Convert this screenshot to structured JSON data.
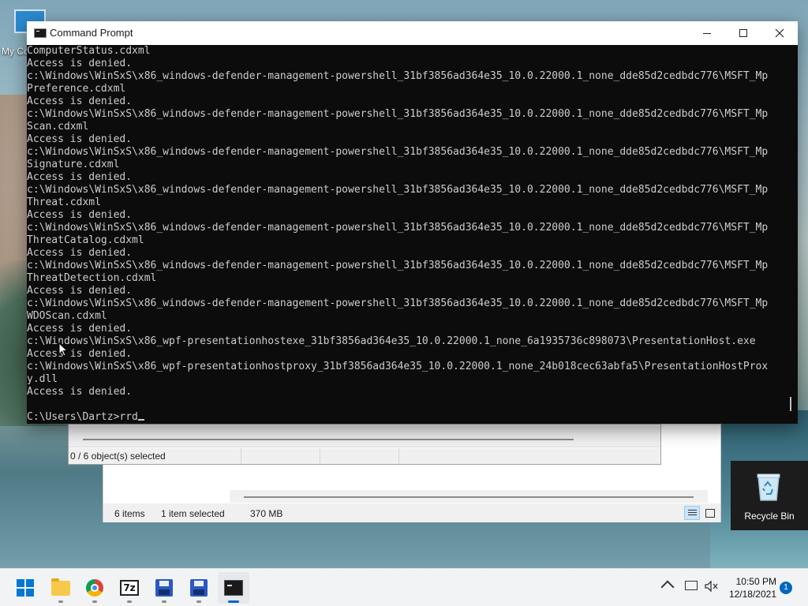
{
  "desktop": {
    "icons": [
      {
        "label": "My Co"
      },
      {
        "label": "Recycle Bin"
      }
    ]
  },
  "explorer_back": {
    "status": {
      "items": "6 items",
      "selected": "1 item selected",
      "size": "370 MB"
    }
  },
  "explorer_front": {
    "status": {
      "selection": "0 / 6 object(s) selected"
    }
  },
  "cmd": {
    "title": "Command Prompt",
    "lines": [
      "ComputerStatus.cdxml",
      "Access is denied.",
      "c:\\Windows\\WinSxS\\x86_windows-defender-management-powershell_31bf3856ad364e35_10.0.22000.1_none_dde85d2cedbdc776\\MSFT_Mp",
      "Preference.cdxml",
      "Access is denied.",
      "c:\\Windows\\WinSxS\\x86_windows-defender-management-powershell_31bf3856ad364e35_10.0.22000.1_none_dde85d2cedbdc776\\MSFT_Mp",
      "Scan.cdxml",
      "Access is denied.",
      "c:\\Windows\\WinSxS\\x86_windows-defender-management-powershell_31bf3856ad364e35_10.0.22000.1_none_dde85d2cedbdc776\\MSFT_Mp",
      "Signature.cdxml",
      "Access is denied.",
      "c:\\Windows\\WinSxS\\x86_windows-defender-management-powershell_31bf3856ad364e35_10.0.22000.1_none_dde85d2cedbdc776\\MSFT_Mp",
      "Threat.cdxml",
      "Access is denied.",
      "c:\\Windows\\WinSxS\\x86_windows-defender-management-powershell_31bf3856ad364e35_10.0.22000.1_none_dde85d2cedbdc776\\MSFT_Mp",
      "ThreatCatalog.cdxml",
      "Access is denied.",
      "c:\\Windows\\WinSxS\\x86_windows-defender-management-powershell_31bf3856ad364e35_10.0.22000.1_none_dde85d2cedbdc776\\MSFT_Mp",
      "ThreatDetection.cdxml",
      "Access is denied.",
      "c:\\Windows\\WinSxS\\x86_windows-defender-management-powershell_31bf3856ad364e35_10.0.22000.1_none_dde85d2cedbdc776\\MSFT_Mp",
      "WDOScan.cdxml",
      "Access is denied.",
      "c:\\Windows\\WinSxS\\x86_wpf-presentationhostexe_31bf3856ad364e35_10.0.22000.1_none_6a1935736c898073\\PresentationHost.exe",
      "Access is denied.",
      "c:\\Windows\\WinSxS\\x86_wpf-presentationhostproxy_31bf3856ad364e35_10.0.22000.1_none_24b018cec63abfa5\\PresentationHostProx",
      "y.dll",
      "Access is denied.",
      ""
    ],
    "prompt": "C:\\Users\\Dartz>rrd"
  },
  "taskbar": {
    "apps": [
      "start-icon",
      "file-explorer-icon",
      "chrome-icon",
      "7zip-icon",
      "floppy-app-icon",
      "floppy-app-icon",
      "command-prompt-icon"
    ],
    "clock": {
      "time": "10:50 PM",
      "date": "12/18/2021"
    },
    "notification_count": "1"
  }
}
